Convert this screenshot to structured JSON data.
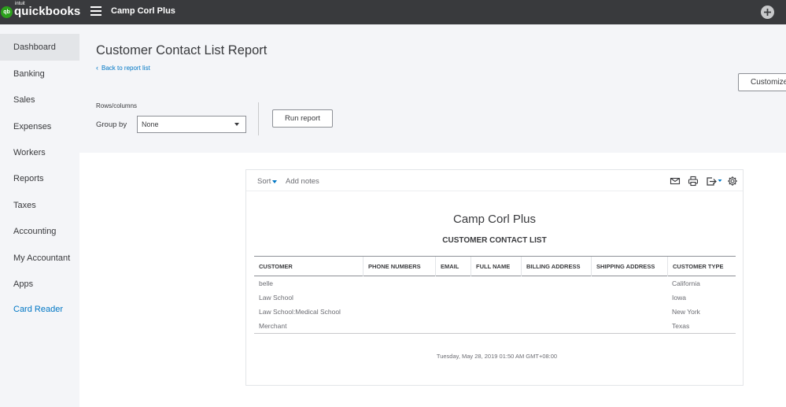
{
  "topbar": {
    "logo_badge": "qb",
    "logo_intuit": "intuit",
    "logo_name": "quickbooks",
    "company_name": "Camp Corl Plus",
    "icons": {
      "menu": "hamburger-menu-icon",
      "create": "plus-circle-icon"
    }
  },
  "sidebar": {
    "items": [
      {
        "label": "Dashboard",
        "active": true
      },
      {
        "label": "Banking"
      },
      {
        "label": "Sales"
      },
      {
        "label": "Expenses"
      },
      {
        "label": "Workers"
      },
      {
        "label": "Reports"
      },
      {
        "label": "Taxes"
      },
      {
        "label": "Accounting"
      },
      {
        "label": "My Accountant"
      },
      {
        "label": "Apps"
      },
      {
        "label": "Card Reader",
        "link": true
      }
    ]
  },
  "header": {
    "title": "Customer Contact List Report",
    "back_link": "Back to report list",
    "customize_label": "Customize",
    "rows_columns_label": "Rows/columns",
    "group_by_label": "Group by",
    "group_by_value": "None",
    "run_report_label": "Run report"
  },
  "report": {
    "toolbar": {
      "sort_label": "Sort",
      "add_notes_label": "Add notes",
      "icons": [
        "email-icon",
        "print-icon",
        "export-icon",
        "settings-gear-icon"
      ]
    },
    "company": "Camp Corl Plus",
    "title": "CUSTOMER CONTACT LIST",
    "columns": [
      "CUSTOMER",
      "PHONE NUMBERS",
      "EMAIL",
      "FULL NAME",
      "BILLING ADDRESS",
      "SHIPPING ADDRESS",
      "CUSTOMER TYPE"
    ],
    "rows": [
      {
        "customer": "belle",
        "customer_type": "California"
      },
      {
        "customer": "Law School",
        "customer_type": "Iowa"
      },
      {
        "customer": "Law School:Medical School",
        "customer_type": "New York"
      },
      {
        "customer": "Merchant",
        "customer_type": "Texas"
      }
    ],
    "timestamp": "Tuesday, May 28, 2019  01:50 AM GMT+08:00"
  },
  "colors": {
    "topbar": "#393a3d",
    "sidebar": "#f4f5f8",
    "active_item": "#e3e5e8",
    "link": "#0077c5",
    "brand_green": "#2ca01c"
  }
}
